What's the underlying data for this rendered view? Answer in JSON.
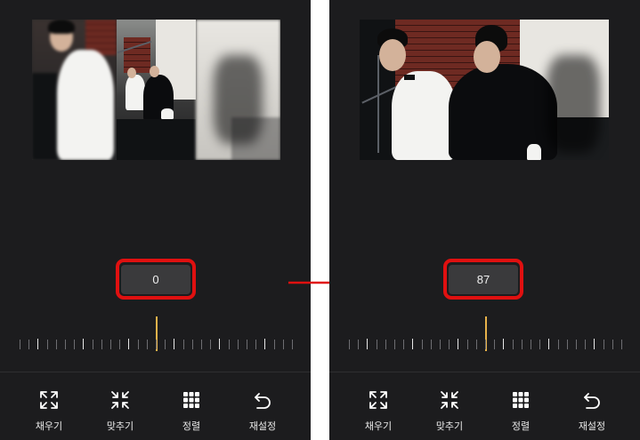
{
  "screens": [
    {
      "id": "before",
      "value_display": "0",
      "slider_level": 0.5,
      "toolbar": [
        {
          "label": "채우기",
          "icon": "expand-icon"
        },
        {
          "label": "맞추기",
          "icon": "compress-icon"
        },
        {
          "label": "정렬",
          "icon": "grid-icon"
        },
        {
          "label": "재설정",
          "icon": "undo-icon"
        }
      ]
    },
    {
      "id": "after",
      "value_display": "87",
      "slider_level": 0.5,
      "toolbar": [
        {
          "label": "채우기",
          "icon": "expand-icon"
        },
        {
          "label": "맞추기",
          "icon": "compress-icon"
        },
        {
          "label": "정렬",
          "icon": "grid-icon"
        },
        {
          "label": "재설정",
          "icon": "undo-icon"
        }
      ]
    }
  ],
  "colors": {
    "background": "#1c1c1e",
    "highlight": "#e01010",
    "slider_thumb": "#e7b24a",
    "value_box": "#3a3a3c"
  },
  "transition_icon": "right-arrow-icon"
}
